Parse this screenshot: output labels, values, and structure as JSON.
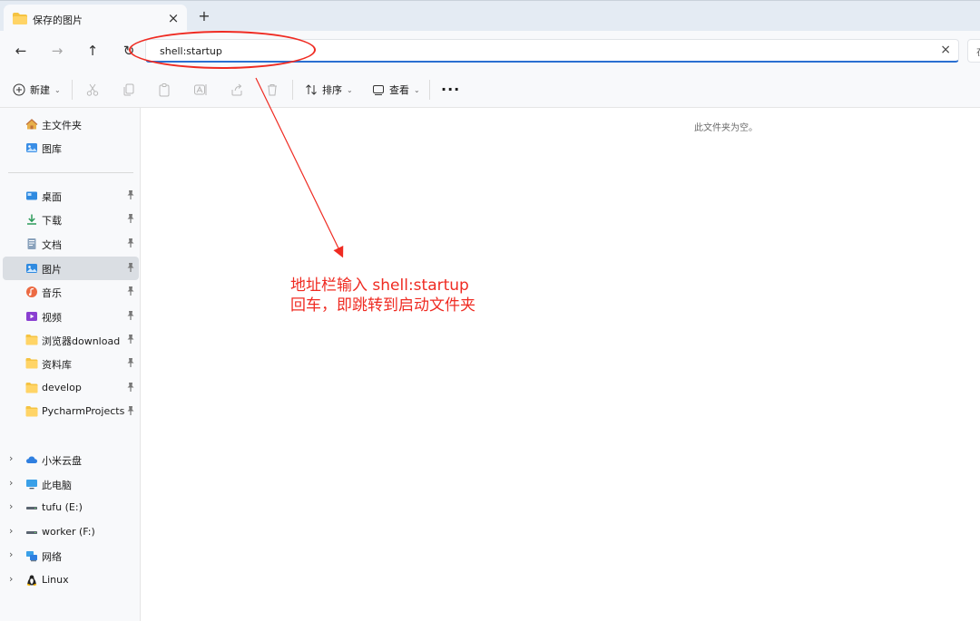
{
  "window": {
    "tab_title": "保存的图片",
    "tab_close_icon": "close-icon",
    "new_tab_glyph": "+"
  },
  "navigation": {
    "back_glyph": "←",
    "forward_glyph": "→",
    "up_glyph": "↑",
    "refresh_glyph": "↻"
  },
  "address_bar": {
    "value": "shell:startup",
    "clear_glyph": "×"
  },
  "search": {
    "glyph": "在"
  },
  "commandbar": {
    "new_label": "新建",
    "sort_label": "排序",
    "view_label": "查看",
    "more_label": "···"
  },
  "sidebar": {
    "quick": [
      {
        "label": "主文件夹",
        "icon": "home-icon"
      },
      {
        "label": "图库",
        "icon": "gallery-icon"
      }
    ],
    "pinned": [
      {
        "label": "桌面",
        "icon": "desktop-icon"
      },
      {
        "label": "下载",
        "icon": "download-icon"
      },
      {
        "label": "文档",
        "icon": "document-icon"
      },
      {
        "label": "图片",
        "icon": "pictures-icon",
        "selected": true
      },
      {
        "label": "音乐",
        "icon": "music-icon"
      },
      {
        "label": "视频",
        "icon": "video-icon"
      },
      {
        "label": "浏览器download",
        "icon": "folder-icon"
      },
      {
        "label": "资料库",
        "icon": "folder-icon"
      },
      {
        "label": "develop",
        "icon": "folder-icon"
      },
      {
        "label": "PycharmProjects",
        "icon": "folder-icon"
      }
    ],
    "devices": [
      {
        "label": "小米云盘",
        "icon": "cloud-icon"
      },
      {
        "label": "此电脑",
        "icon": "computer-icon"
      },
      {
        "label": "tufu (E:)",
        "icon": "drive-icon"
      },
      {
        "label": "worker (F:)",
        "icon": "drive-icon"
      },
      {
        "label": "网络",
        "icon": "network-icon"
      },
      {
        "label": "Linux",
        "icon": "linux-icon"
      }
    ]
  },
  "content": {
    "empty_message": "此文件夹为空。"
  },
  "annotation": {
    "line1": "地址栏输入 shell:startup",
    "line2": "回车，即跳转到启动文件夹",
    "color": "#ef2b22"
  },
  "colors": {
    "accent": "#2a6fd1",
    "folder": "#f5c342",
    "selected_bg": "#dadee3"
  }
}
